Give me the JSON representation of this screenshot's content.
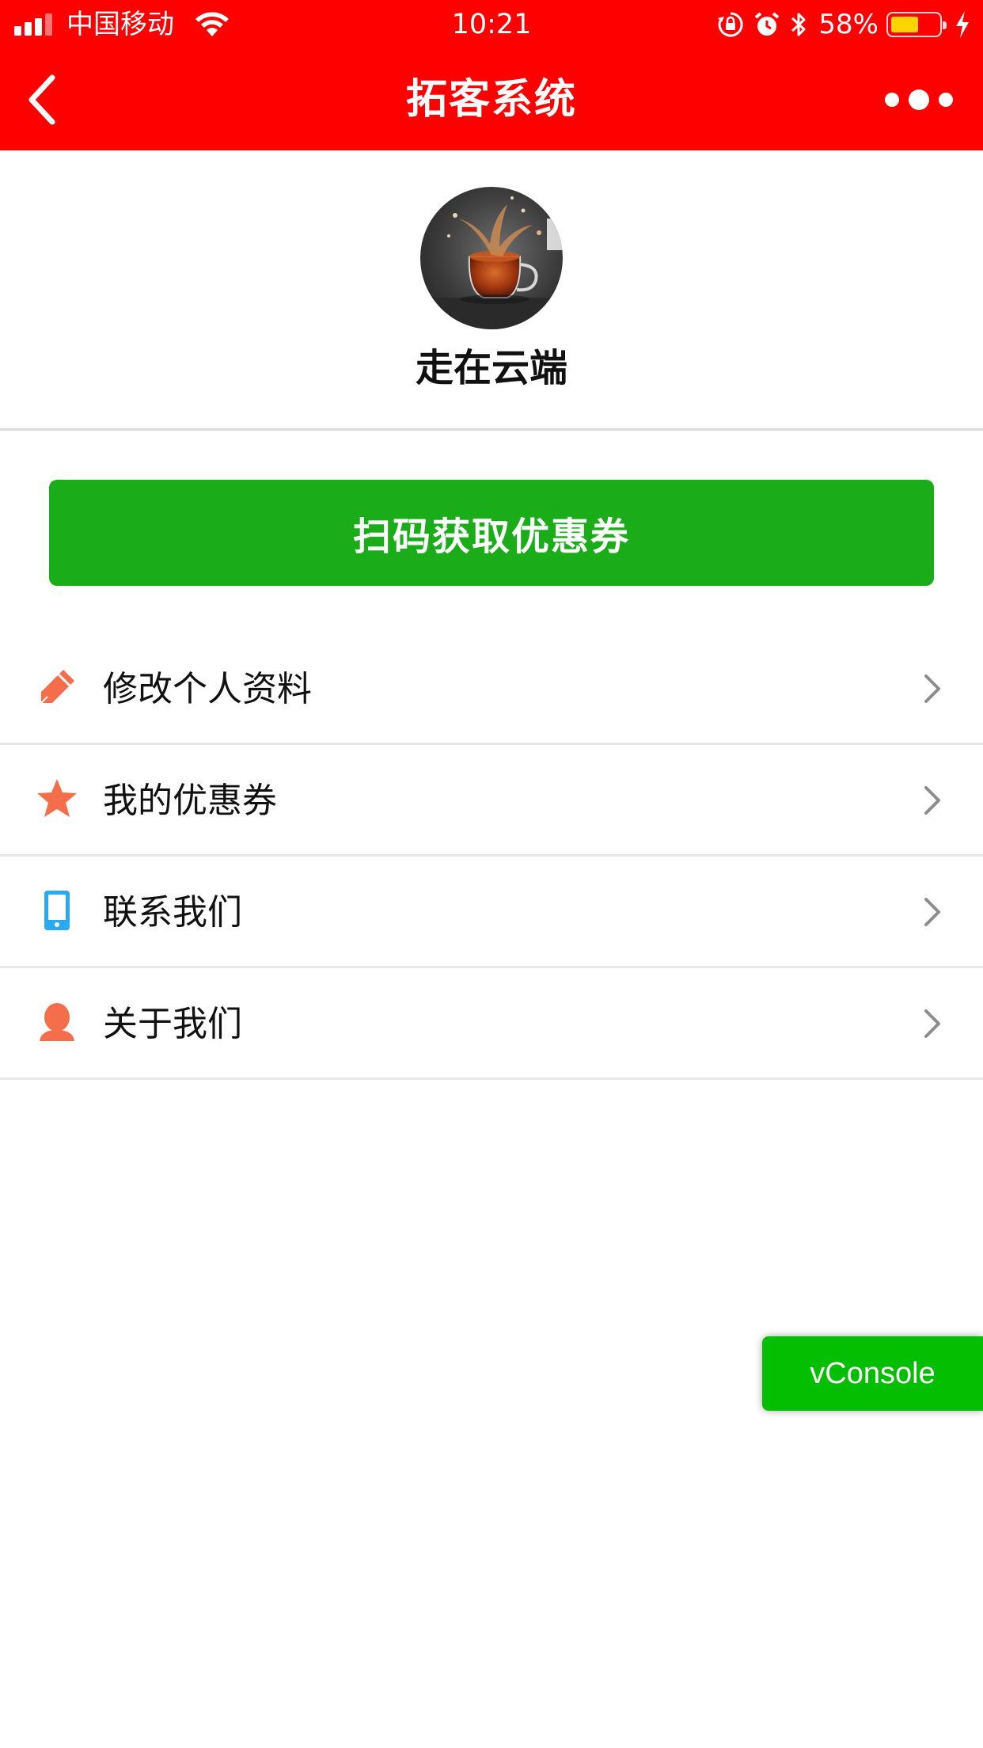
{
  "status_bar": {
    "carrier": "中国移动",
    "time": "10:21",
    "battery": "58%",
    "battery_level": 0.58,
    "icons": [
      "signal-icon",
      "wifi-icon",
      "orientation-lock-icon",
      "alarm-icon",
      "bluetooth-icon",
      "battery-icon",
      "charging-icon"
    ]
  },
  "nav": {
    "title": "拓客系统",
    "back_icon": "chevron-left-icon",
    "more_icon": "more-dots-icon"
  },
  "profile": {
    "name": "走在云端"
  },
  "scan_button": {
    "label": "扫码获取优惠券"
  },
  "menu": [
    {
      "label": "修改个人资料",
      "icon": "pencil-icon"
    },
    {
      "label": "我的优惠券",
      "icon": "star-icon"
    },
    {
      "label": "联系我们",
      "icon": "phone-icon"
    },
    {
      "label": "关于我们",
      "icon": "person-icon"
    }
  ],
  "vconsole": {
    "label": "vConsole"
  },
  "colors": {
    "header_bg": "#ff0000",
    "button_green": "#1aad19",
    "vconsole_green": "#04be02",
    "icon_orange": "#f46e4b",
    "icon_blue": "#29a9f0",
    "arrow_gray": "#8c8c8c",
    "battery_yellow": "#ffd400"
  }
}
